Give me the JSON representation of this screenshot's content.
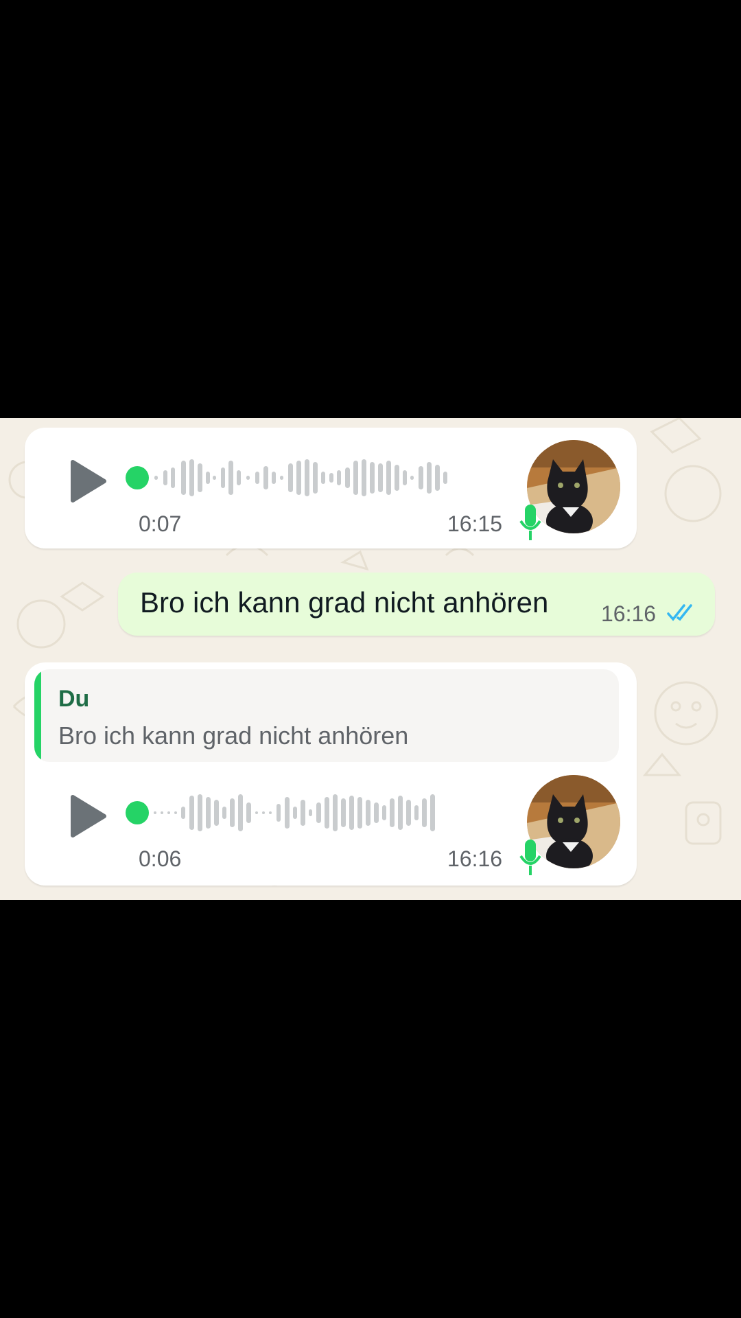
{
  "messages": [
    {
      "type": "voice",
      "direction": "incoming",
      "duration": "0:07",
      "time": "16:15",
      "play_icon": "play-icon",
      "mic_icon": "mic-icon"
    },
    {
      "type": "text",
      "direction": "outgoing",
      "text": "Bro ich kann grad nicht anhören",
      "time": "16:16",
      "status_icon": "double-check-icon"
    },
    {
      "type": "voice",
      "direction": "incoming",
      "reply_to": {
        "author": "Du",
        "text": "Bro ich kann grad nicht anhören"
      },
      "duration": "0:06",
      "time": "16:16",
      "play_icon": "play-icon",
      "mic_icon": "mic-icon"
    }
  ],
  "colors": {
    "chat_background": "#f4efe6",
    "incoming_bubble": "#ffffff",
    "outgoing_bubble": "#e7fcd9",
    "accent_green": "#25d366",
    "read_ticks": "#34b7f1",
    "quote_author": "#1f6d46"
  }
}
